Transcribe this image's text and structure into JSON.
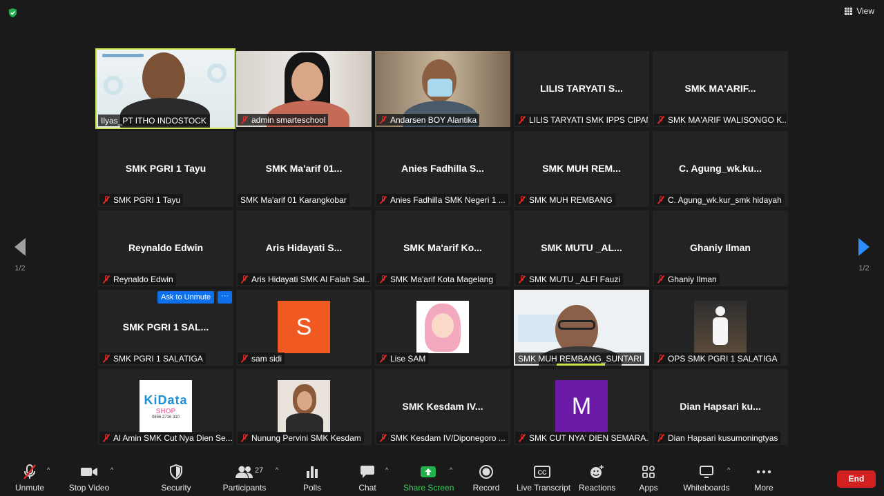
{
  "top": {
    "view_label": "View"
  },
  "pager": {
    "left": "1/2",
    "right": "1/2"
  },
  "tiles": [
    {
      "bigname": "",
      "label": "Ilyas_PT ITHO INDOSTOCK",
      "muted": false,
      "type": "video"
    },
    {
      "bigname": "",
      "label": "admin smarteschool",
      "muted": true,
      "type": "video"
    },
    {
      "bigname": "",
      "label": "Andarsen BOY Alantika",
      "muted": true,
      "type": "video"
    },
    {
      "bigname": "LILIS TARYATI S...",
      "label": "LILIS TARYATI SMK IPPS CIPAN...",
      "muted": true
    },
    {
      "bigname": "SMK MA'ARIF...",
      "label": "SMK MA'ARIF WALISONGO K...",
      "muted": true
    },
    {
      "bigname": "SMK PGRI 1 Tayu",
      "label": "SMK PGRI 1 Tayu",
      "muted": true
    },
    {
      "bigname": "SMK Ma'arif 01...",
      "label": "SMK Ma'arif 01 Karangkobar",
      "muted": false
    },
    {
      "bigname": "Anies Fadhilla S...",
      "label": "Anies Fadhilla SMK Negeri 1 ...",
      "muted": true
    },
    {
      "bigname": "SMK MUH REM...",
      "label": "SMK MUH REMBANG",
      "muted": true
    },
    {
      "bigname": "C. Agung_wk.ku...",
      "label": "C. Agung_wk.kur_smk hidayah",
      "muted": true
    },
    {
      "bigname": "Reynaldo Edwin",
      "label": "Reynaldo Edwin",
      "muted": true
    },
    {
      "bigname": "Aris Hidayati S...",
      "label": "Aris Hidayati SMK Al Falah Sal...",
      "muted": true
    },
    {
      "bigname": "SMK Ma'arif Ko...",
      "label": "SMK Ma'arif Kota Magelang",
      "muted": true
    },
    {
      "bigname": "SMK MUTU _AL...",
      "label": "SMK MUTU _ALFI Fauzi",
      "muted": true
    },
    {
      "bigname": "Ghaniy Ilman",
      "label": "Ghaniy Ilman",
      "muted": true
    },
    {
      "bigname": "SMK PGRI 1 SAL...",
      "label": "SMK PGRI 1 SALATIGA",
      "muted": true
    },
    {
      "bigname": "",
      "label": "sam sidi",
      "muted": true,
      "avatar": "S",
      "avatar_color": "#f05a22"
    },
    {
      "bigname": "",
      "label": "Lise SAM",
      "muted": true,
      "type": "hijab"
    },
    {
      "bigname": "",
      "label": "SMK MUH REMBANG_SUNTARI",
      "muted": false,
      "type": "video"
    },
    {
      "bigname": "",
      "label": "OPS SMK PGRI 1 SALATIGA",
      "muted": true,
      "type": "photo"
    },
    {
      "bigname": "",
      "label": "Al Amin SMK Cut Nya Dien Se...",
      "muted": true,
      "type": "shop"
    },
    {
      "bigname": "",
      "label": "Nunung Pervini SMK Kesdam",
      "muted": true,
      "type": "photo2"
    },
    {
      "bigname": "SMK Kesdam IV...",
      "label": "SMK Kesdam IV/Diponegoro ...",
      "muted": true
    },
    {
      "bigname": "",
      "label": "SMK CUT NYA' DIEN SEMARA...",
      "muted": true,
      "avatar": "M",
      "avatar_color": "#6a1aa7"
    },
    {
      "bigname": "Dian Hapsari ku...",
      "label": "Dian Hapsari kusumoningtyas",
      "muted": true
    }
  ],
  "overlay": {
    "ask_unmute": "Ask to Unmute",
    "more": "···"
  },
  "shop_logo": {
    "line1": "KiData",
    "line2": "SHOP",
    "phone": "0856 2716 310"
  },
  "toolbar": {
    "unmute": "Unmute",
    "stop_video": "Stop Video",
    "security": "Security",
    "participants": "Participants",
    "participants_count": "27",
    "polls": "Polls",
    "chat": "Chat",
    "share_screen": "Share Screen",
    "record": "Record",
    "live_transcript": "Live Transcript",
    "reactions": "Reactions",
    "apps": "Apps",
    "whiteboards": "Whiteboards",
    "more": "More",
    "end": "End"
  }
}
